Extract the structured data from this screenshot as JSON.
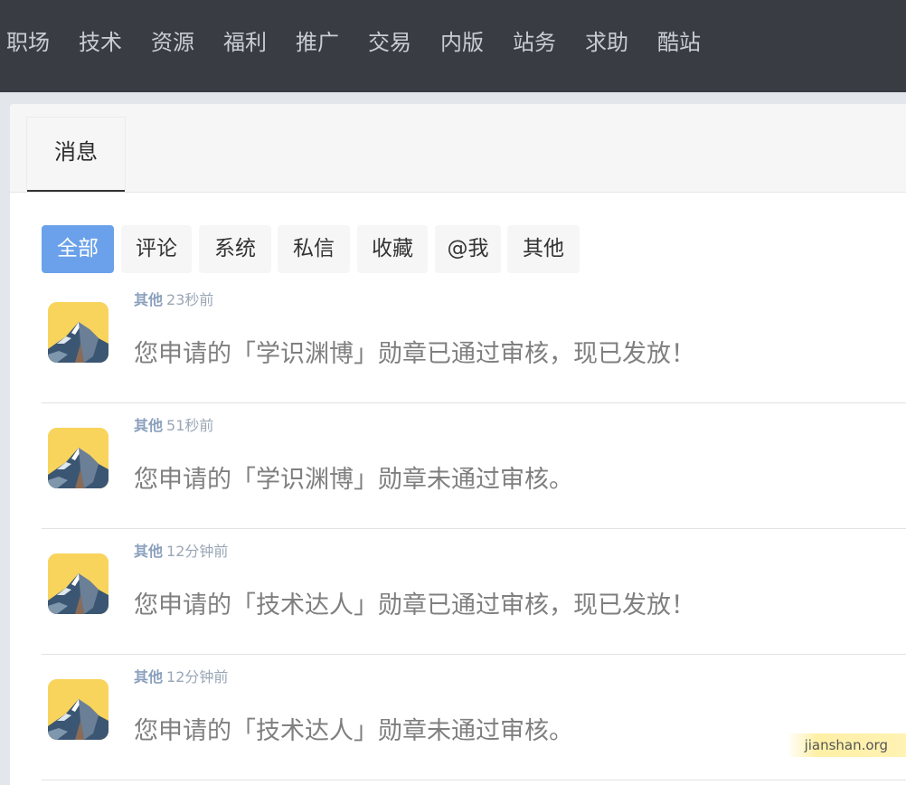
{
  "topnav": {
    "items": [
      "职场",
      "技术",
      "资源",
      "福利",
      "推广",
      "交易",
      "内版",
      "站务",
      "求助",
      "酷站"
    ]
  },
  "tabs": {
    "active_label": "消息"
  },
  "filters": [
    {
      "label": "全部",
      "active": true
    },
    {
      "label": "评论",
      "active": false
    },
    {
      "label": "系统",
      "active": false
    },
    {
      "label": "私信",
      "active": false
    },
    {
      "label": "收藏",
      "active": false
    },
    {
      "label": "@我",
      "active": false
    },
    {
      "label": "其他",
      "active": false
    }
  ],
  "messages": [
    {
      "type": "其他",
      "time": "23秒前",
      "text": "您申请的「学识渊博」勋章已通过审核，现已发放！"
    },
    {
      "type": "其他",
      "time": "51秒前",
      "text": "您申请的「学识渊博」勋章未通过审核。"
    },
    {
      "type": "其他",
      "time": "12分钟前",
      "text": "您申请的「技术达人」勋章已通过审核，现已发放！"
    },
    {
      "type": "其他",
      "time": "12分钟前",
      "text": "您申请的「技术达人」勋章未通过审核。"
    }
  ],
  "watermark": "jianshan.org",
  "colors": {
    "topnav_bg": "#393d43",
    "accent": "#6aa1ea",
    "meta_type": "#8aa0bd"
  },
  "icons": {
    "avatar": "mountain-icon"
  }
}
